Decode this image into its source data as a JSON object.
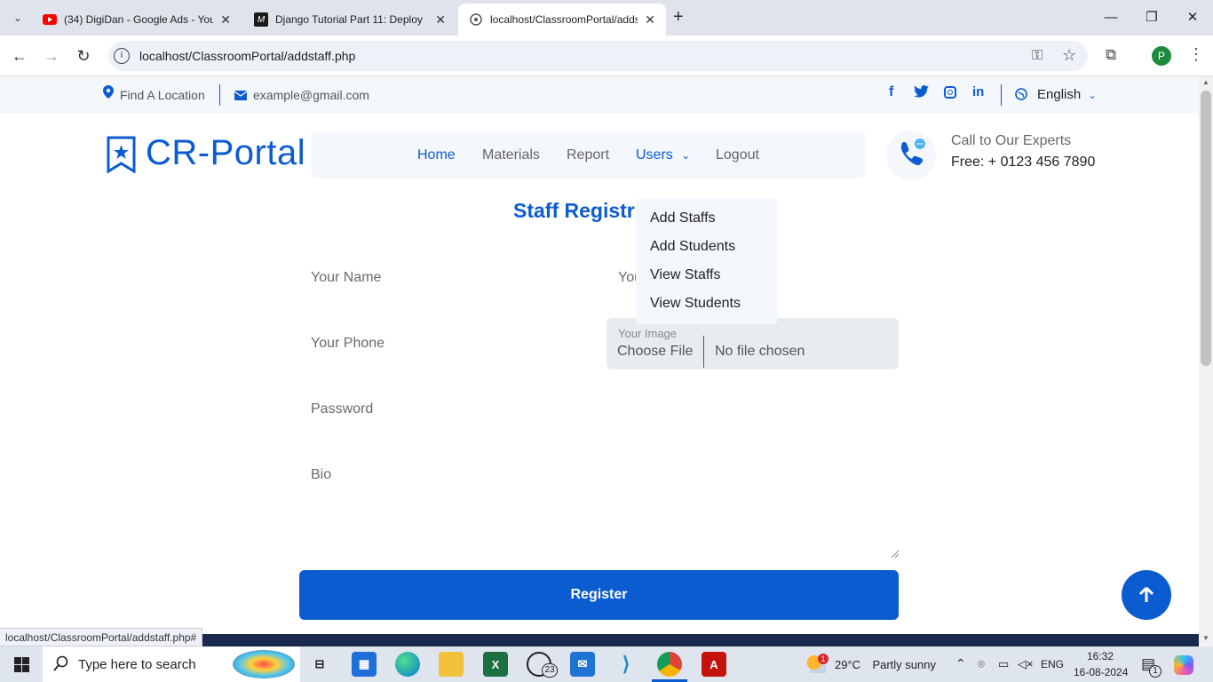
{
  "browser": {
    "tabs": [
      {
        "title": "(34) DigiDan - Google Ads - You",
        "icon": "youtube-icon"
      },
      {
        "title": "Django Tutorial Part 11: Deploy",
        "icon": "mdn-icon"
      },
      {
        "title": "localhost/ClassroomPortal/adds",
        "icon": "globe-icon"
      }
    ],
    "url": "localhost/ClassroomPortal/addstaff.php",
    "profile_initial": "P",
    "status_url": "localhost/ClassroomPortal/addstaff.php#"
  },
  "topbar": {
    "location": "Find A Location",
    "email": "example@gmail.com",
    "language": "English"
  },
  "header": {
    "logo": "CR-Portal",
    "nav": [
      {
        "label": "Home"
      },
      {
        "label": "Materials"
      },
      {
        "label": "Report"
      },
      {
        "label": "Users"
      },
      {
        "label": "Logout"
      }
    ],
    "call_label": "Call to Our Experts",
    "call_number": "Free: + 0123 456 7890"
  },
  "dropdown": {
    "items": [
      "Add Staffs",
      "Add Students",
      "View Staffs",
      "View Students"
    ]
  },
  "form": {
    "title": "Staff Registr",
    "name_placeholder": "Your Name",
    "email_placeholder": "You",
    "phone_placeholder": "Your Phone",
    "image_label": "Your Image",
    "file_button": "Choose File",
    "file_status": "No file chosen",
    "password_placeholder": "Password",
    "bio_placeholder": "Bio",
    "register_label": "Register"
  },
  "taskbar": {
    "search_placeholder": "Type here to search",
    "whatsapp_badge": "23",
    "weather_badge": "1",
    "temperature": "29°C",
    "weather": "Partly sunny",
    "language": "ENG",
    "time": "16:32",
    "date": "16-08-2024",
    "notification_count": "1"
  },
  "colors": {
    "brand": "#0b5cd1",
    "topbar_bg": "#f4f7fb",
    "footer": "#1a2a4d"
  }
}
